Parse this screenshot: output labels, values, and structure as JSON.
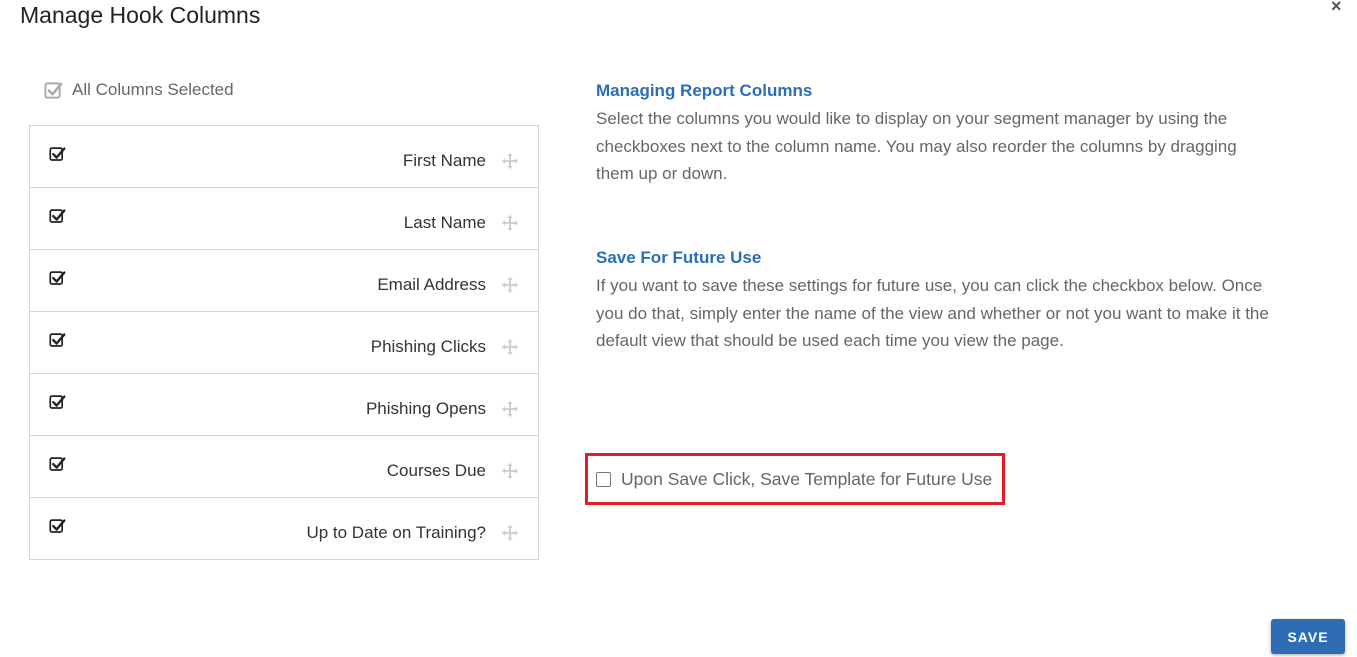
{
  "modal": {
    "title": "Manage Hook Columns",
    "close_icon": "close-icon"
  },
  "columns": {
    "all_selected_label": "All Columns Selected",
    "items": [
      {
        "label": "First Name",
        "checked": true
      },
      {
        "label": "Last Name",
        "checked": true
      },
      {
        "label": "Email Address",
        "checked": true
      },
      {
        "label": "Phishing Clicks",
        "checked": true
      },
      {
        "label": "Phishing Opens",
        "checked": true
      },
      {
        "label": "Courses Due",
        "checked": true
      },
      {
        "label": "Up to Date on Training?",
        "checked": true
      }
    ]
  },
  "info": {
    "managing_title": "Managing Report Columns",
    "managing_text": "Select the columns you would like to display on your segment manager by using the checkboxes next to the column name. You may also reorder the columns by dragging them up or down.",
    "save_title": "Save For Future Use",
    "save_text": "If you want to save these settings for future use, you can click the checkbox below. Once you do that, simply enter the name of the view and whether or not you want to make it the default view that should be used each time you view the page."
  },
  "save_template": {
    "label": "Upon Save Click, Save Template for Future Use",
    "checked": false
  },
  "footer": {
    "save_label": "SAVE"
  },
  "colors": {
    "accent_heading": "#2a6ebb",
    "save_button": "#2e6db4",
    "highlight_border": "#e01e26"
  }
}
